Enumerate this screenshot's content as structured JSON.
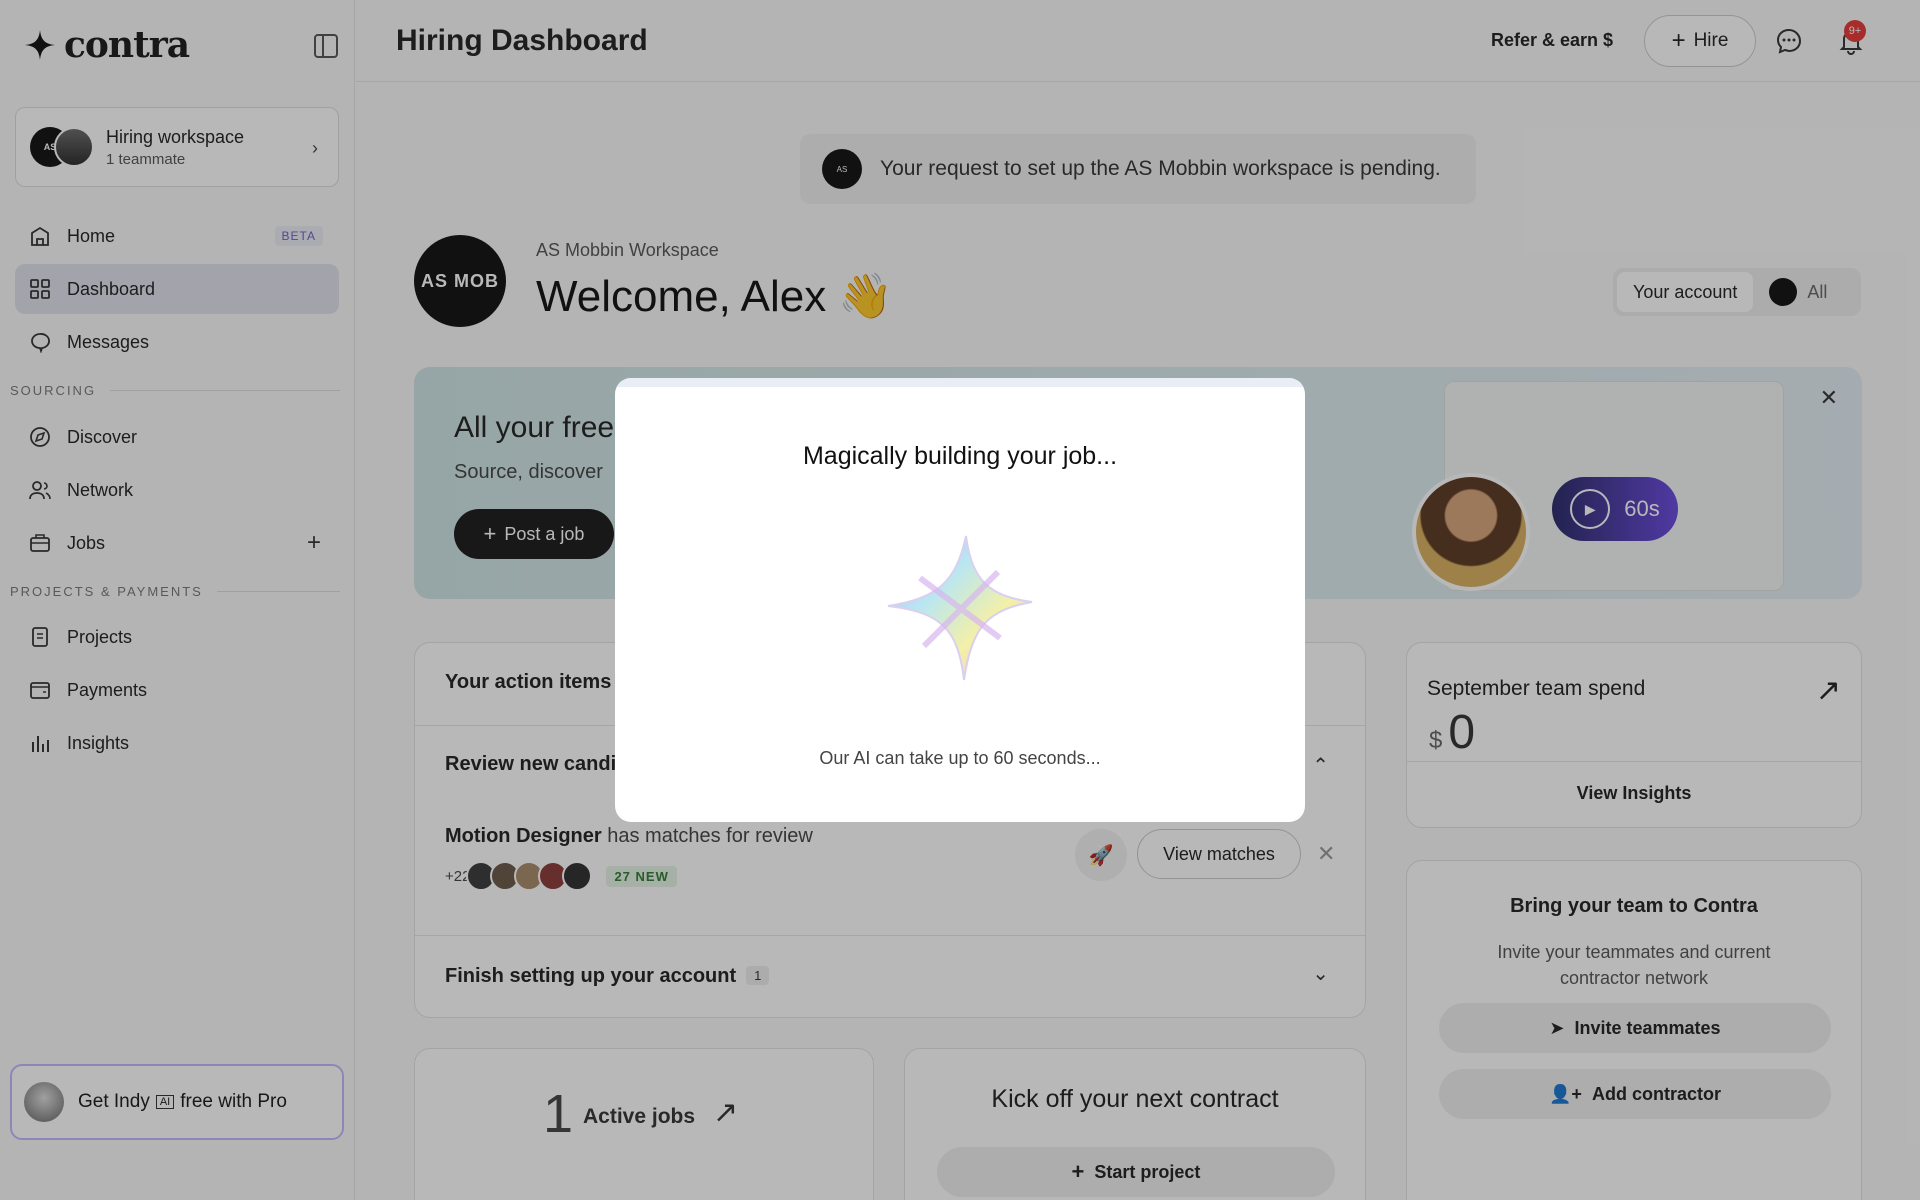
{
  "brand": {
    "name": "contra"
  },
  "sidebar": {
    "workspace": {
      "title": "Hiring workspace",
      "subtitle": "1 teammate"
    },
    "items": [
      {
        "label": "Home",
        "badge": "BETA",
        "icon": "home-icon"
      },
      {
        "label": "Dashboard",
        "icon": "grid-icon",
        "active": true
      },
      {
        "label": "Messages",
        "icon": "chat-icon"
      }
    ],
    "sourcing_label": "SOURCING",
    "sourcing_items": [
      {
        "label": "Discover",
        "icon": "compass-icon"
      },
      {
        "label": "Network",
        "icon": "people-icon"
      },
      {
        "label": "Jobs",
        "icon": "briefcase-icon"
      }
    ],
    "projects_label": "PROJECTS & PAYMENTS",
    "projects_items": [
      {
        "label": "Projects",
        "icon": "document-icon"
      },
      {
        "label": "Payments",
        "icon": "wallet-icon"
      },
      {
        "label": "Insights",
        "icon": "bar-chart-icon"
      }
    ],
    "indy": {
      "prefix": "Get Indy",
      "ai": "AI",
      "suffix": "free with Pro"
    }
  },
  "header": {
    "title": "Hiring Dashboard",
    "refer": "Refer & earn $",
    "hire": "Hire",
    "notifications": "9+"
  },
  "main": {
    "pending": "Your request to set up the AS Mobbin workspace is pending.",
    "workspace_name": "AS Mobbin Workspace",
    "welcome": "Welcome, Alex 👋",
    "avatar_text": "AS MOB",
    "account_toggle": {
      "selected": "Your account",
      "other": "All"
    },
    "promo": {
      "title": "All your free",
      "subtitle": "Source, discover",
      "cta": "Post a job",
      "video": "60s"
    },
    "actions": {
      "title": "Your action items",
      "review_title": "Review new candi",
      "job_name": "Motion Designer",
      "job_suffix": "has matches for review",
      "plus_count": "+22",
      "new_badge": "27 NEW",
      "view_matches": "View matches",
      "finish_title": "Finish setting up your account",
      "finish_count": "1"
    },
    "spend": {
      "title": "September team spend",
      "currency": "$",
      "value": "0",
      "link": "View Insights"
    },
    "team": {
      "title": "Bring your team to Contra",
      "subtitle": "Invite your teammates and current contractor network",
      "invite": "Invite teammates",
      "add": "Add contractor"
    },
    "jobs": {
      "count": "1",
      "label": "Active jobs"
    },
    "contract": {
      "title": "Kick off your next contract",
      "start": "Start project"
    }
  },
  "modal": {
    "title": "Magically building your job...",
    "note": "Our AI can take up to 60 seconds..."
  },
  "colors": {
    "accent": "#6b5fc8",
    "active_nav": "#e1e1ee",
    "new_badge": "#2e7d32",
    "notification": "#e53935"
  }
}
